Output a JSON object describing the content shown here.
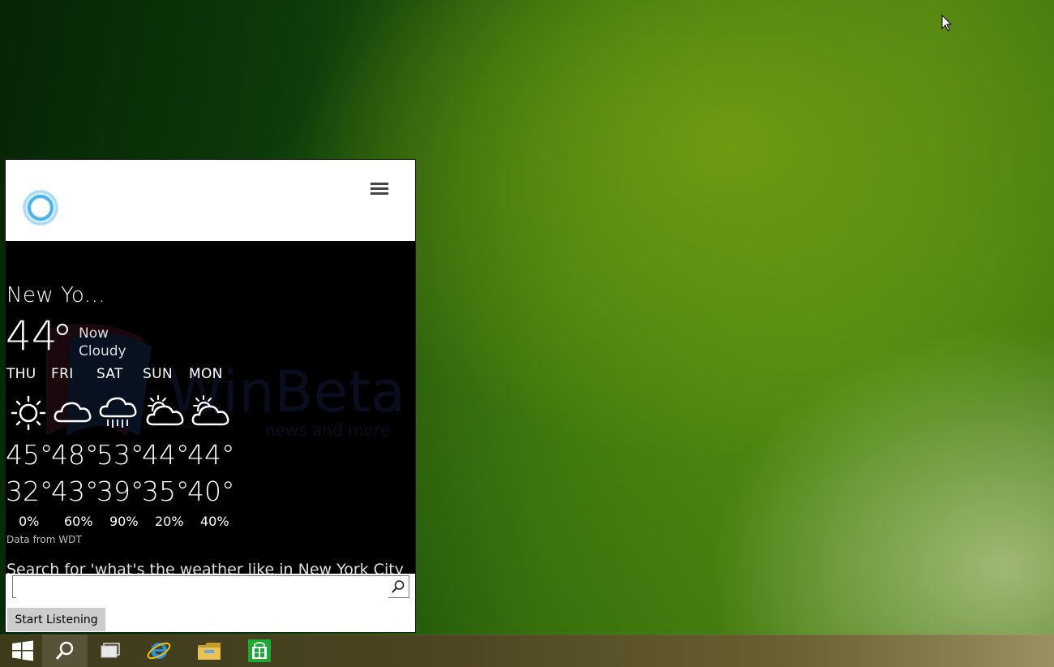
{
  "cortana": {
    "menu_icon": "hamburger-icon",
    "logo_icon": "cortana-ring-icon"
  },
  "weather": {
    "city": "New Yo...",
    "current_temp": "44",
    "now_label": "Now",
    "now_condition": "Cloudy",
    "days": [
      {
        "name": "THU",
        "icon": "sunny-icon",
        "high": "45°",
        "low": "32°",
        "precip": "0%"
      },
      {
        "name": "FRI",
        "icon": "cloudy-icon",
        "high": "48°",
        "low": "43°",
        "precip": "60%"
      },
      {
        "name": "SAT",
        "icon": "rain-icon",
        "high": "53°",
        "low": "39°",
        "precip": "90%"
      },
      {
        "name": "SUN",
        "icon": "partly-cloudy-icon",
        "high": "44°",
        "low": "35°",
        "precip": "20%"
      },
      {
        "name": "MON",
        "icon": "partly-cloudy-icon",
        "high": "44°",
        "low": "40°",
        "precip": "40%"
      }
    ],
    "source": "Data from WDT",
    "search_hint": "Search for 'what's the weather like in New York City"
  },
  "search": {
    "value": "",
    "placeholder": "",
    "button_label": "Start Listening"
  },
  "taskbar": {
    "items": [
      "windows-start-icon",
      "search-icon",
      "task-view-icon",
      "internet-explorer-icon",
      "file-explorer-icon",
      "store-icon"
    ]
  },
  "colors": {
    "accent": "#4fb3e8",
    "panel_bg": "#000000",
    "store_green": "#1ea838",
    "ie_blue": "#2a8fe0",
    "folder_yellow": "#e8c257"
  }
}
